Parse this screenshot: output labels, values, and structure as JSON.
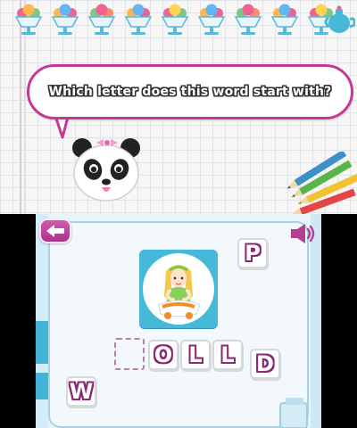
{
  "prompt": {
    "question": "Which letter does this word start with?"
  },
  "colors": {
    "accent_magenta": "#c43a92",
    "tile_outline": "#8a2a70",
    "picture_background": "#46b9d9",
    "panel_border": "#a7d3e6"
  },
  "icons": {
    "back": "back-arrow-icon",
    "sound": "speaker-icon",
    "mascot": "panda-icon",
    "picture": "doll-picture-icon",
    "decorations": [
      "ice-cream-cup-icon",
      "teapot-icon",
      "pencils-icon"
    ]
  },
  "word": {
    "tiles": [
      "O",
      "L",
      "L",
      "D"
    ]
  },
  "choices": {
    "option_top": "P",
    "option_left": "W"
  }
}
